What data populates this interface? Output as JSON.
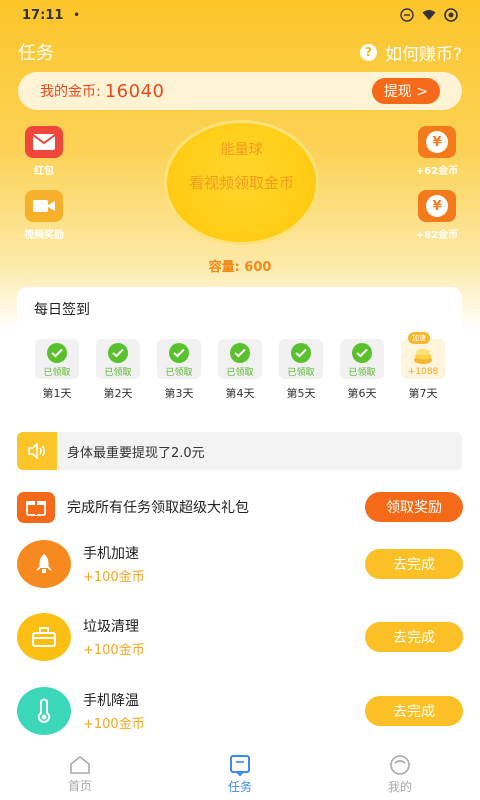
{
  "status": {
    "time": "17:11",
    "dot": "•"
  },
  "header": {
    "title": "任务",
    "help_label": "如何赚币?",
    "help_icon": "?"
  },
  "coins": {
    "label": "我的金币:",
    "value": "16040",
    "withdraw_label": "提现 >"
  },
  "side": {
    "red_packet": "红包",
    "video_reward": "视频奖励",
    "coin_top": "+62金币",
    "coin_bottom": "+82金币",
    "yen": "¥"
  },
  "orb": {
    "title": "能量球",
    "action": "看视频领取金币"
  },
  "capacity": "容量: 600",
  "signin": {
    "title": "每日签到",
    "days": [
      {
        "status": "已领取",
        "label": "第1天"
      },
      {
        "status": "已领取",
        "label": "第2天"
      },
      {
        "status": "已领取",
        "label": "第3天"
      },
      {
        "status": "已领取",
        "label": "第4天"
      },
      {
        "status": "已领取",
        "label": "第5天"
      },
      {
        "status": "已领取",
        "label": "第6天"
      },
      {
        "status": "+1088",
        "label": "第7天",
        "badge": "加速"
      }
    ]
  },
  "notice": "身体最重要提现了2.0元",
  "big_task": {
    "text": "完成所有任务领取超级大礼包",
    "button": "领取奖励"
  },
  "tasks": [
    {
      "name": "手机加速",
      "reward": "+100金币",
      "button": "去完成"
    },
    {
      "name": "垃圾清理",
      "reward": "+100金币",
      "button": "去完成"
    },
    {
      "name": "手机降温",
      "reward": "+100金币",
      "button": "去完成"
    }
  ],
  "tabs": [
    {
      "label": "首页"
    },
    {
      "label": "任务"
    },
    {
      "label": "我的"
    }
  ],
  "colors": {
    "primary": "#fbc52a",
    "accent_orange": "#f56a19",
    "check_green": "#58c12c",
    "tab_active": "#3a88f0"
  }
}
